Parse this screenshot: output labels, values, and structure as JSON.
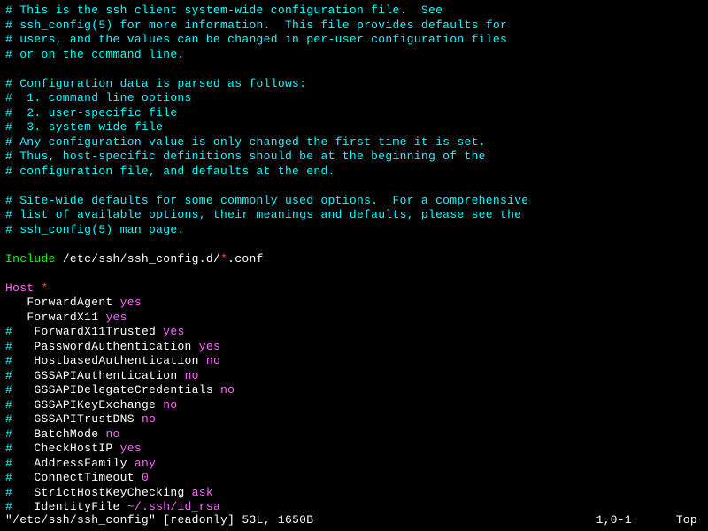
{
  "lines": [
    {
      "type": "comment",
      "text": "# This is the ssh client system-wide configuration file.  See"
    },
    {
      "type": "comment",
      "text": "# ssh_config(5) for more information.  This file provides defaults for"
    },
    {
      "type": "comment",
      "text": "# users, and the values can be changed in per-user configuration files"
    },
    {
      "type": "comment",
      "text": "# or on the command line."
    },
    {
      "type": "blank",
      "text": ""
    },
    {
      "type": "comment",
      "text": "# Configuration data is parsed as follows:"
    },
    {
      "type": "comment",
      "text": "#  1. command line options"
    },
    {
      "type": "comment",
      "text": "#  2. user-specific file"
    },
    {
      "type": "comment",
      "text": "#  3. system-wide file"
    },
    {
      "type": "comment",
      "text": "# Any configuration value is only changed the first time it is set."
    },
    {
      "type": "comment",
      "text": "# Thus, host-specific definitions should be at the beginning of the"
    },
    {
      "type": "comment",
      "text": "# configuration file, and defaults at the end."
    },
    {
      "type": "blank",
      "text": ""
    },
    {
      "type": "comment",
      "text": "# Site-wide defaults for some commonly used options.  For a comprehensive"
    },
    {
      "type": "comment",
      "text": "# list of available options, their meanings and defaults, please see the"
    },
    {
      "type": "comment",
      "text": "# ssh_config(5) man page."
    },
    {
      "type": "blank",
      "text": ""
    },
    {
      "type": "include",
      "keyword": "Include",
      "path": " /etc/ssh/ssh_config.d/",
      "glob": "*",
      "suffix": ".conf"
    },
    {
      "type": "blank",
      "text": ""
    },
    {
      "type": "host",
      "keyword": "Host",
      "glob": " *"
    },
    {
      "type": "setting",
      "indent": "   ",
      "option": "ForwardAgent ",
      "value": "yes"
    },
    {
      "type": "setting",
      "indent": "   ",
      "option": "ForwardX11 ",
      "value": "yes"
    },
    {
      "type": "csetting",
      "hash": "#",
      "indent": "   ",
      "option": "ForwardX11Trusted ",
      "value": "yes"
    },
    {
      "type": "csetting",
      "hash": "#",
      "indent": "   ",
      "option": "PasswordAuthentication ",
      "value": "yes"
    },
    {
      "type": "csetting",
      "hash": "#",
      "indent": "   ",
      "option": "HostbasedAuthentication ",
      "value": "no"
    },
    {
      "type": "csetting",
      "hash": "#",
      "indent": "   ",
      "option": "GSSAPIAuthentication ",
      "value": "no"
    },
    {
      "type": "csetting",
      "hash": "#",
      "indent": "   ",
      "option": "GSSAPIDelegateCredentials ",
      "value": "no"
    },
    {
      "type": "csetting",
      "hash": "#",
      "indent": "   ",
      "option": "GSSAPIKeyExchange ",
      "value": "no"
    },
    {
      "type": "csetting",
      "hash": "#",
      "indent": "   ",
      "option": "GSSAPITrustDNS ",
      "value": "no"
    },
    {
      "type": "csetting",
      "hash": "#",
      "indent": "   ",
      "option": "BatchMode ",
      "value": "no"
    },
    {
      "type": "csetting",
      "hash": "#",
      "indent": "   ",
      "option": "CheckHostIP ",
      "value": "yes"
    },
    {
      "type": "csetting",
      "hash": "#",
      "indent": "   ",
      "option": "AddressFamily ",
      "value": "any"
    },
    {
      "type": "csetting",
      "hash": "#",
      "indent": "   ",
      "option": "ConnectTimeout ",
      "value": "0"
    },
    {
      "type": "csetting",
      "hash": "#",
      "indent": "   ",
      "option": "StrictHostKeyChecking ",
      "value": "ask"
    },
    {
      "type": "csetting",
      "hash": "#",
      "indent": "   ",
      "option": "IdentityFile ",
      "value": "~/.ssh/id_rsa"
    }
  ],
  "status": {
    "filename": "\"/etc/ssh/ssh_config\"",
    "readonly": " [readonly] ",
    "info": "53L, 1650B",
    "pos": "1,0-1",
    "loc": "Top"
  }
}
